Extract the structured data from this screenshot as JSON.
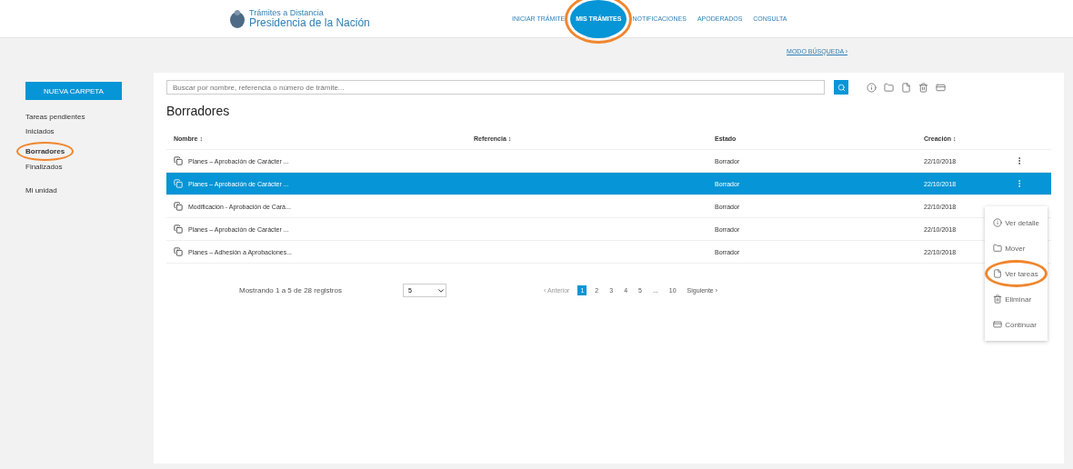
{
  "header": {
    "logo_line1": "Trámites a Distancia",
    "logo_line2": "Presidencia de la Nación",
    "nav": [
      {
        "label": "INICIAR TRÁMITE",
        "selected": false,
        "highlighted": false
      },
      {
        "label": "MIS TRÁMITES",
        "selected": true,
        "highlighted": true
      },
      {
        "label": "NOTIFICACIONES",
        "selected": false,
        "highlighted": false
      },
      {
        "label": "APODERADOS",
        "selected": false,
        "highlighted": false
      },
      {
        "label": "CONSULTA",
        "selected": false,
        "highlighted": false
      }
    ]
  },
  "subbar": {
    "link": "MODO BÚSQUEDA ›"
  },
  "sidebar": {
    "new_folder": "NUEVA CARPETA",
    "items": [
      {
        "label": "Tareas pendientes",
        "selected": false,
        "highlighted": false
      },
      {
        "label": "Iniciados",
        "selected": false,
        "highlighted": false
      },
      {
        "label": "Borradores",
        "selected": true,
        "highlighted": true
      },
      {
        "label": "Finalizados",
        "selected": false,
        "highlighted": false
      },
      {
        "label": "Mi unidad",
        "selected": false,
        "highlighted": false
      }
    ]
  },
  "search": {
    "placeholder": "Buscar por nombre, referencia o número de trámite..."
  },
  "title": "Borradores",
  "table": {
    "columns": [
      "Nombre ↕",
      "Referencia ↕",
      "Estado",
      "Creación ↕"
    ],
    "rows": [
      {
        "name": "Planes – Aprobación de Carácter ...",
        "status": "Borrador",
        "date": "22/10/2018",
        "selected": false,
        "menu_button": true
      },
      {
        "name": "Planes – Aprobación de Carácter ...",
        "status": "Borrador",
        "date": "22/10/2018",
        "selected": true,
        "menu_button": true
      },
      {
        "name": "Modificación - Aprobación de Cará...",
        "status": "Borrador",
        "date": "22/10/2018",
        "selected": false
      },
      {
        "name": "Planes – Aprobación de Carácter ...",
        "status": "Borrador",
        "date": "22/10/2018",
        "selected": false
      },
      {
        "name": "Planes – Adhesión a Aprobaciones...",
        "status": "Borrador",
        "date": "22/10/2018",
        "selected": false
      }
    ]
  },
  "menu": [
    {
      "kind": "info",
      "label": "Ver detalle",
      "highlighted": false
    },
    {
      "kind": "folder",
      "label": "Mover",
      "highlighted": false
    },
    {
      "kind": "doc",
      "label": "Ver tareas",
      "highlighted": true
    },
    {
      "kind": "trash",
      "label": "Eliminar",
      "highlighted": false
    },
    {
      "kind": "card",
      "label": "Continuar",
      "highlighted": false
    }
  ],
  "footer": {
    "summary": "Mostrando 1 a 5 de 28 registros",
    "page_size": "5",
    "prev": {
      "label": "‹ Anterior",
      "disabled": true
    },
    "pages": [
      {
        "label": "1",
        "selected": true
      },
      {
        "label": "2",
        "selected": false
      },
      {
        "label": "3",
        "selected": false
      },
      {
        "label": "4",
        "selected": false
      },
      {
        "label": "5",
        "selected": false
      },
      {
        "label": "...",
        "selected": false
      },
      {
        "label": "10",
        "selected": false
      }
    ],
    "next": {
      "label": "Siguiente ›",
      "disabled": false
    }
  }
}
